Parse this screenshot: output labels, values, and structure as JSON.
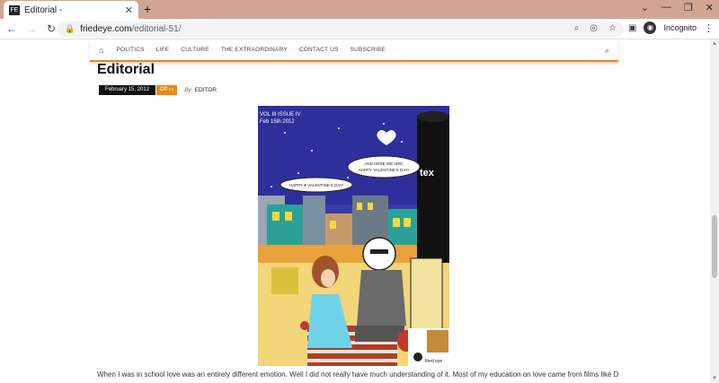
{
  "browser": {
    "tab_title": "Editorial -",
    "favicon_text": "FE",
    "url_domain": "friedeye.com",
    "url_path": "/editorial-51/",
    "incognito_label": "Incognito"
  },
  "nav": {
    "items": [
      "POLITICS",
      "LIFE",
      "CULTURE",
      "THE EXTRAORDINARY",
      "CONTACT US",
      "SUBSCRIBE"
    ]
  },
  "article": {
    "title": "Editorial",
    "date": "February 15, 2012",
    "comments": "Off",
    "by_prefix": "By",
    "author": "EDITOR",
    "body_start": "When I was in school love was an entirely different emotion. Well I did not really have much understanding of it. Most of my education on love came from films like Dil and Maine"
  },
  "comic": {
    "issue_line1": "VOL III ISSUE IV",
    "issue_line2": "Feb 15th 2012",
    "bubble_girl": "HAPPY ♥ VALENTINE'S DAY!",
    "bubble_boy_line1": "AND HERE WE ARE!",
    "bubble_boy_line2": "HAPPY VALENTINE'S DAY!",
    "tower_text": "tex",
    "logo_text": "fried eye"
  },
  "colors": {
    "accent": "#e8881a",
    "sky": "#3a3aa8",
    "tabstrip": "#d2a593"
  }
}
